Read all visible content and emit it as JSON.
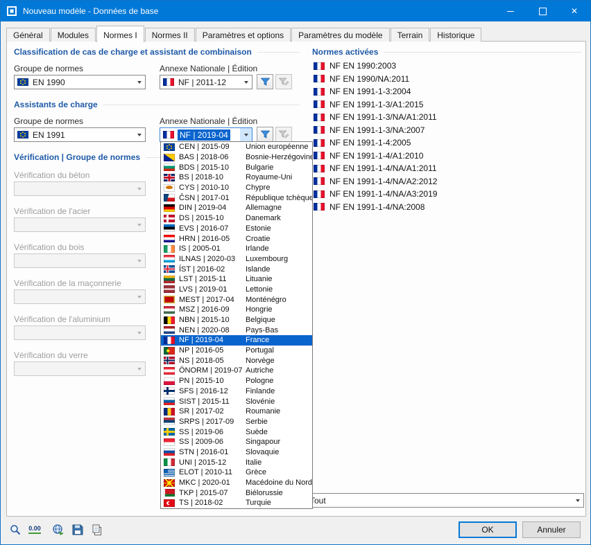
{
  "window": {
    "title": "Nouveau modèle - Données de base"
  },
  "tabs": [
    "Général",
    "Modules",
    "Normes I",
    "Normes II",
    "Paramètres et options",
    "Paramètres du modèle",
    "Terrain",
    "Historique"
  ],
  "active_tab": "Normes I",
  "classification": {
    "heading": "Classification de cas de charge et assistant de combinaison",
    "groupe_label": "Groupe de normes",
    "groupe_value": "EN 1990",
    "groupe_flag": "eu",
    "annexe_label": "Annexe Nationale | Édition",
    "annexe_value": "NF | 2011-12",
    "annexe_flag": "fr"
  },
  "assistants": {
    "heading": "Assistants de charge",
    "groupe_label": "Groupe de normes",
    "groupe_value": "EN 1991",
    "groupe_flag": "eu",
    "annexe_label": "Annexe Nationale | Édition",
    "annexe_value": "NF | 2019-04",
    "annexe_flag": "fr"
  },
  "verification": {
    "heading": "Vérification | Groupe de normes",
    "fields": [
      "Vérification du béton",
      "Vérification de l'acier",
      "Vérification du bois",
      "Vérification de la maçonnerie",
      "Vérification de l'aluminium",
      "Vérification du verre"
    ]
  },
  "annex_dropdown": {
    "selected": "NF | 2019-04",
    "items": [
      {
        "code": "CEN | 2015-09",
        "country": "Union européenne",
        "flag": "eu"
      },
      {
        "code": "BAS | 2018-06",
        "country": "Bosnie-Herzégovine",
        "flag": "ba"
      },
      {
        "code": "BDS | 2015-10",
        "country": "Bulgarie",
        "flag": "bg"
      },
      {
        "code": "BS | 2018-10",
        "country": "Royaume-Uni",
        "flag": "gb"
      },
      {
        "code": "CYS | 2010-10",
        "country": "Chypre",
        "flag": "cy"
      },
      {
        "code": "ČSN | 2017-01",
        "country": "République tchèque",
        "flag": "cz"
      },
      {
        "code": "DIN | 2019-04",
        "country": "Allemagne",
        "flag": "de"
      },
      {
        "code": "DS | 2015-10",
        "country": "Danemark",
        "flag": "dk"
      },
      {
        "code": "EVS | 2016-07",
        "country": "Estonie",
        "flag": "ee"
      },
      {
        "code": "HRN | 2016-05",
        "country": "Croatie",
        "flag": "hr"
      },
      {
        "code": "IS | 2005-01",
        "country": "Irlande",
        "flag": "ie"
      },
      {
        "code": "ILNAS | 2020-03",
        "country": "Luxembourg",
        "flag": "lu"
      },
      {
        "code": "ÍST | 2016-02",
        "country": "Islande",
        "flag": "is"
      },
      {
        "code": "LST | 2015-11",
        "country": "Lituanie",
        "flag": "lt"
      },
      {
        "code": "LVS | 2019-01",
        "country": "Lettonie",
        "flag": "lv"
      },
      {
        "code": "MEST | 2017-04",
        "country": "Monténégro",
        "flag": "me"
      },
      {
        "code": "MSZ | 2016-09",
        "country": "Hongrie",
        "flag": "hu"
      },
      {
        "code": "NBN | 2015-10",
        "country": "Belgique",
        "flag": "be"
      },
      {
        "code": "NEN | 2020-08",
        "country": "Pays-Bas",
        "flag": "nl"
      },
      {
        "code": "NF | 2019-04",
        "country": "France",
        "flag": "fr",
        "selected": true
      },
      {
        "code": "NP | 2016-05",
        "country": "Portugal",
        "flag": "pt"
      },
      {
        "code": "NS | 2018-05",
        "country": "Norvège",
        "flag": "no"
      },
      {
        "code": "ÖNORM | 2019-07",
        "country": "Autriche",
        "flag": "at"
      },
      {
        "code": "PN | 2015-10",
        "country": "Pologne",
        "flag": "pl"
      },
      {
        "code": "SFS | 2016-12",
        "country": "Finlande",
        "flag": "fi"
      },
      {
        "code": "SIST | 2015-11",
        "country": "Slovénie",
        "flag": "si"
      },
      {
        "code": "SR | 2017-02",
        "country": "Roumanie",
        "flag": "ro"
      },
      {
        "code": "SRPS | 2017-09",
        "country": "Serbie",
        "flag": "rs"
      },
      {
        "code": "SS | 2019-06",
        "country": "Suède",
        "flag": "se"
      },
      {
        "code": "SS | 2009-06",
        "country": "Singapour",
        "flag": "sg"
      },
      {
        "code": "STN | 2016-01",
        "country": "Slovaquie",
        "flag": "sk"
      },
      {
        "code": "UNI | 2015-12",
        "country": "Italie",
        "flag": "it"
      },
      {
        "code": "ELOT | 2010-11",
        "country": "Grèce",
        "flag": "gr"
      },
      {
        "code": "MKC | 2020-01",
        "country": "Macédoine du Nord",
        "flag": "mk"
      },
      {
        "code": "TKP | 2015-07",
        "country": "Biélorussie",
        "flag": "by"
      },
      {
        "code": "TS | 2018-02",
        "country": "Turquie",
        "flag": "tr"
      }
    ]
  },
  "normes_activees": {
    "heading": "Normes activées",
    "items": [
      {
        "label": "NF EN 1990:2003",
        "flag": "fr"
      },
      {
        "label": "NF EN 1990/NA:2011",
        "flag": "fr"
      },
      {
        "label": "NF EN 1991-1-3:2004",
        "flag": "fr"
      },
      {
        "label": "NF EN 1991-1-3/A1:2015",
        "flag": "fr"
      },
      {
        "label": "NF EN 1991-1-3/NA/A1:2011",
        "flag": "fr"
      },
      {
        "label": "NF EN 1991-1-3/NA:2007",
        "flag": "fr"
      },
      {
        "label": "NF EN 1991-1-4:2005",
        "flag": "fr"
      },
      {
        "label": "NF EN 1991-1-4/A1:2010",
        "flag": "fr"
      },
      {
        "label": "NF EN 1991-1-4/NA/A1:2011",
        "flag": "fr"
      },
      {
        "label": "NF EN 1991-1-4/NA/A2:2012",
        "flag": "fr"
      },
      {
        "label": "NF EN 1991-1-4/NA/A3:2019",
        "flag": "fr"
      },
      {
        "label": "NF EN 1991-1-4/NA:2008",
        "flag": "fr"
      }
    ],
    "filter_value": "Tout"
  },
  "footer": {
    "units_label": "0.00",
    "ok": "OK",
    "cancel": "Annuler"
  }
}
